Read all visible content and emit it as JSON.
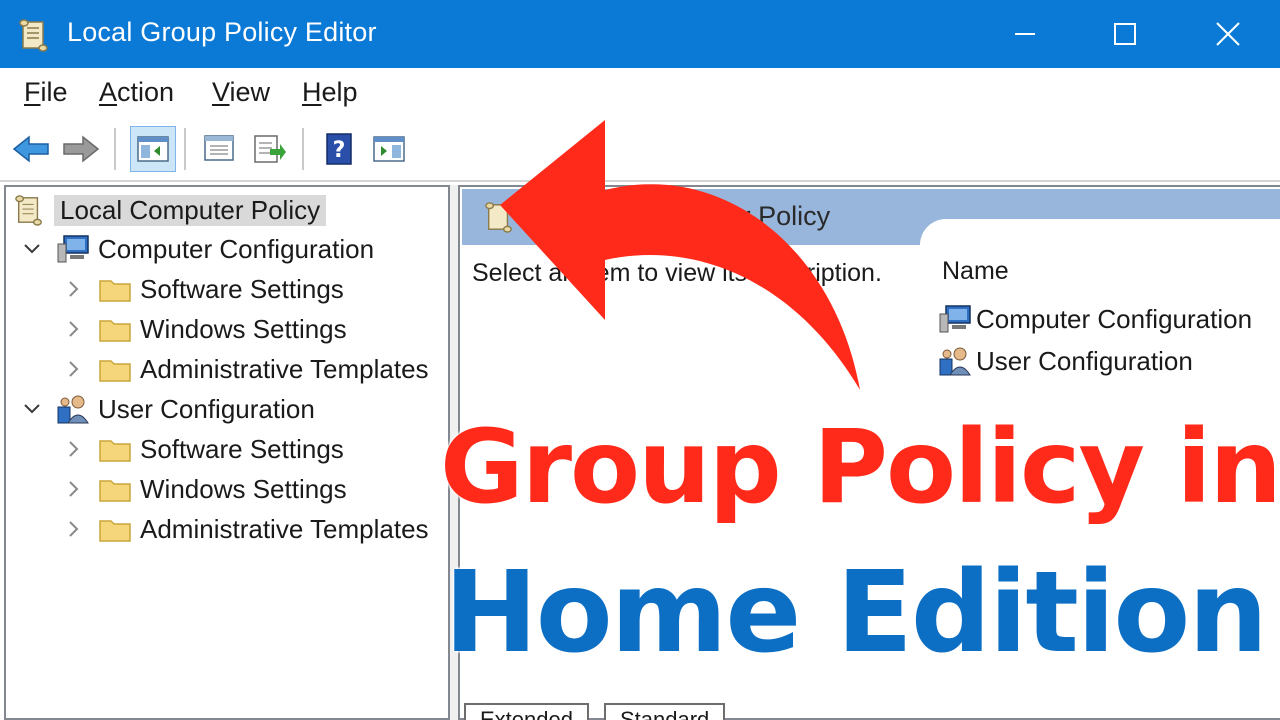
{
  "window": {
    "title": "Local Group Policy Editor",
    "controls": {
      "minimize_icon": "minimize-icon",
      "maximize_icon": "maximize-icon",
      "close_icon": "close-icon"
    }
  },
  "menu": [
    {
      "accel": "F",
      "rest": "ile"
    },
    {
      "accel": "A",
      "rest": "ction"
    },
    {
      "accel": "V",
      "rest": "iew"
    },
    {
      "accel": "H",
      "rest": "elp"
    }
  ],
  "toolbar": {
    "buttons": [
      "back-arrow-icon",
      "forward-arrow-icon",
      "show-hide-console-tree-icon",
      "properties-icon",
      "export-list-icon",
      "help-icon",
      "show-hide-action-pane-icon"
    ]
  },
  "tree": {
    "root": "Local Computer Policy",
    "nodes": [
      {
        "label": "Computer Configuration",
        "children": [
          "Software Settings",
          "Windows Settings",
          "Administrative Templates"
        ]
      },
      {
        "label": "User Configuration",
        "children": [
          "Software Settings",
          "Windows Settings",
          "Administrative Templates"
        ]
      }
    ]
  },
  "detail": {
    "header_title": "Local Computer Policy",
    "description": "Select an item to view its description.",
    "column_name": "Name",
    "items": [
      "Computer Configuration",
      "User Configuration"
    ]
  },
  "tabs": [
    "Extended",
    "Standard"
  ],
  "overlay": {
    "line1": "Group Policy in",
    "line2": "Home Edition",
    "arrow_color": "#ff2a1a",
    "line1_color": "#ff2a1a",
    "line2_color": "#0d6fc4"
  },
  "colors": {
    "titlebar": "#0b79d6",
    "detail_header": "#98b6dc",
    "selection": "#d9d9d9"
  }
}
